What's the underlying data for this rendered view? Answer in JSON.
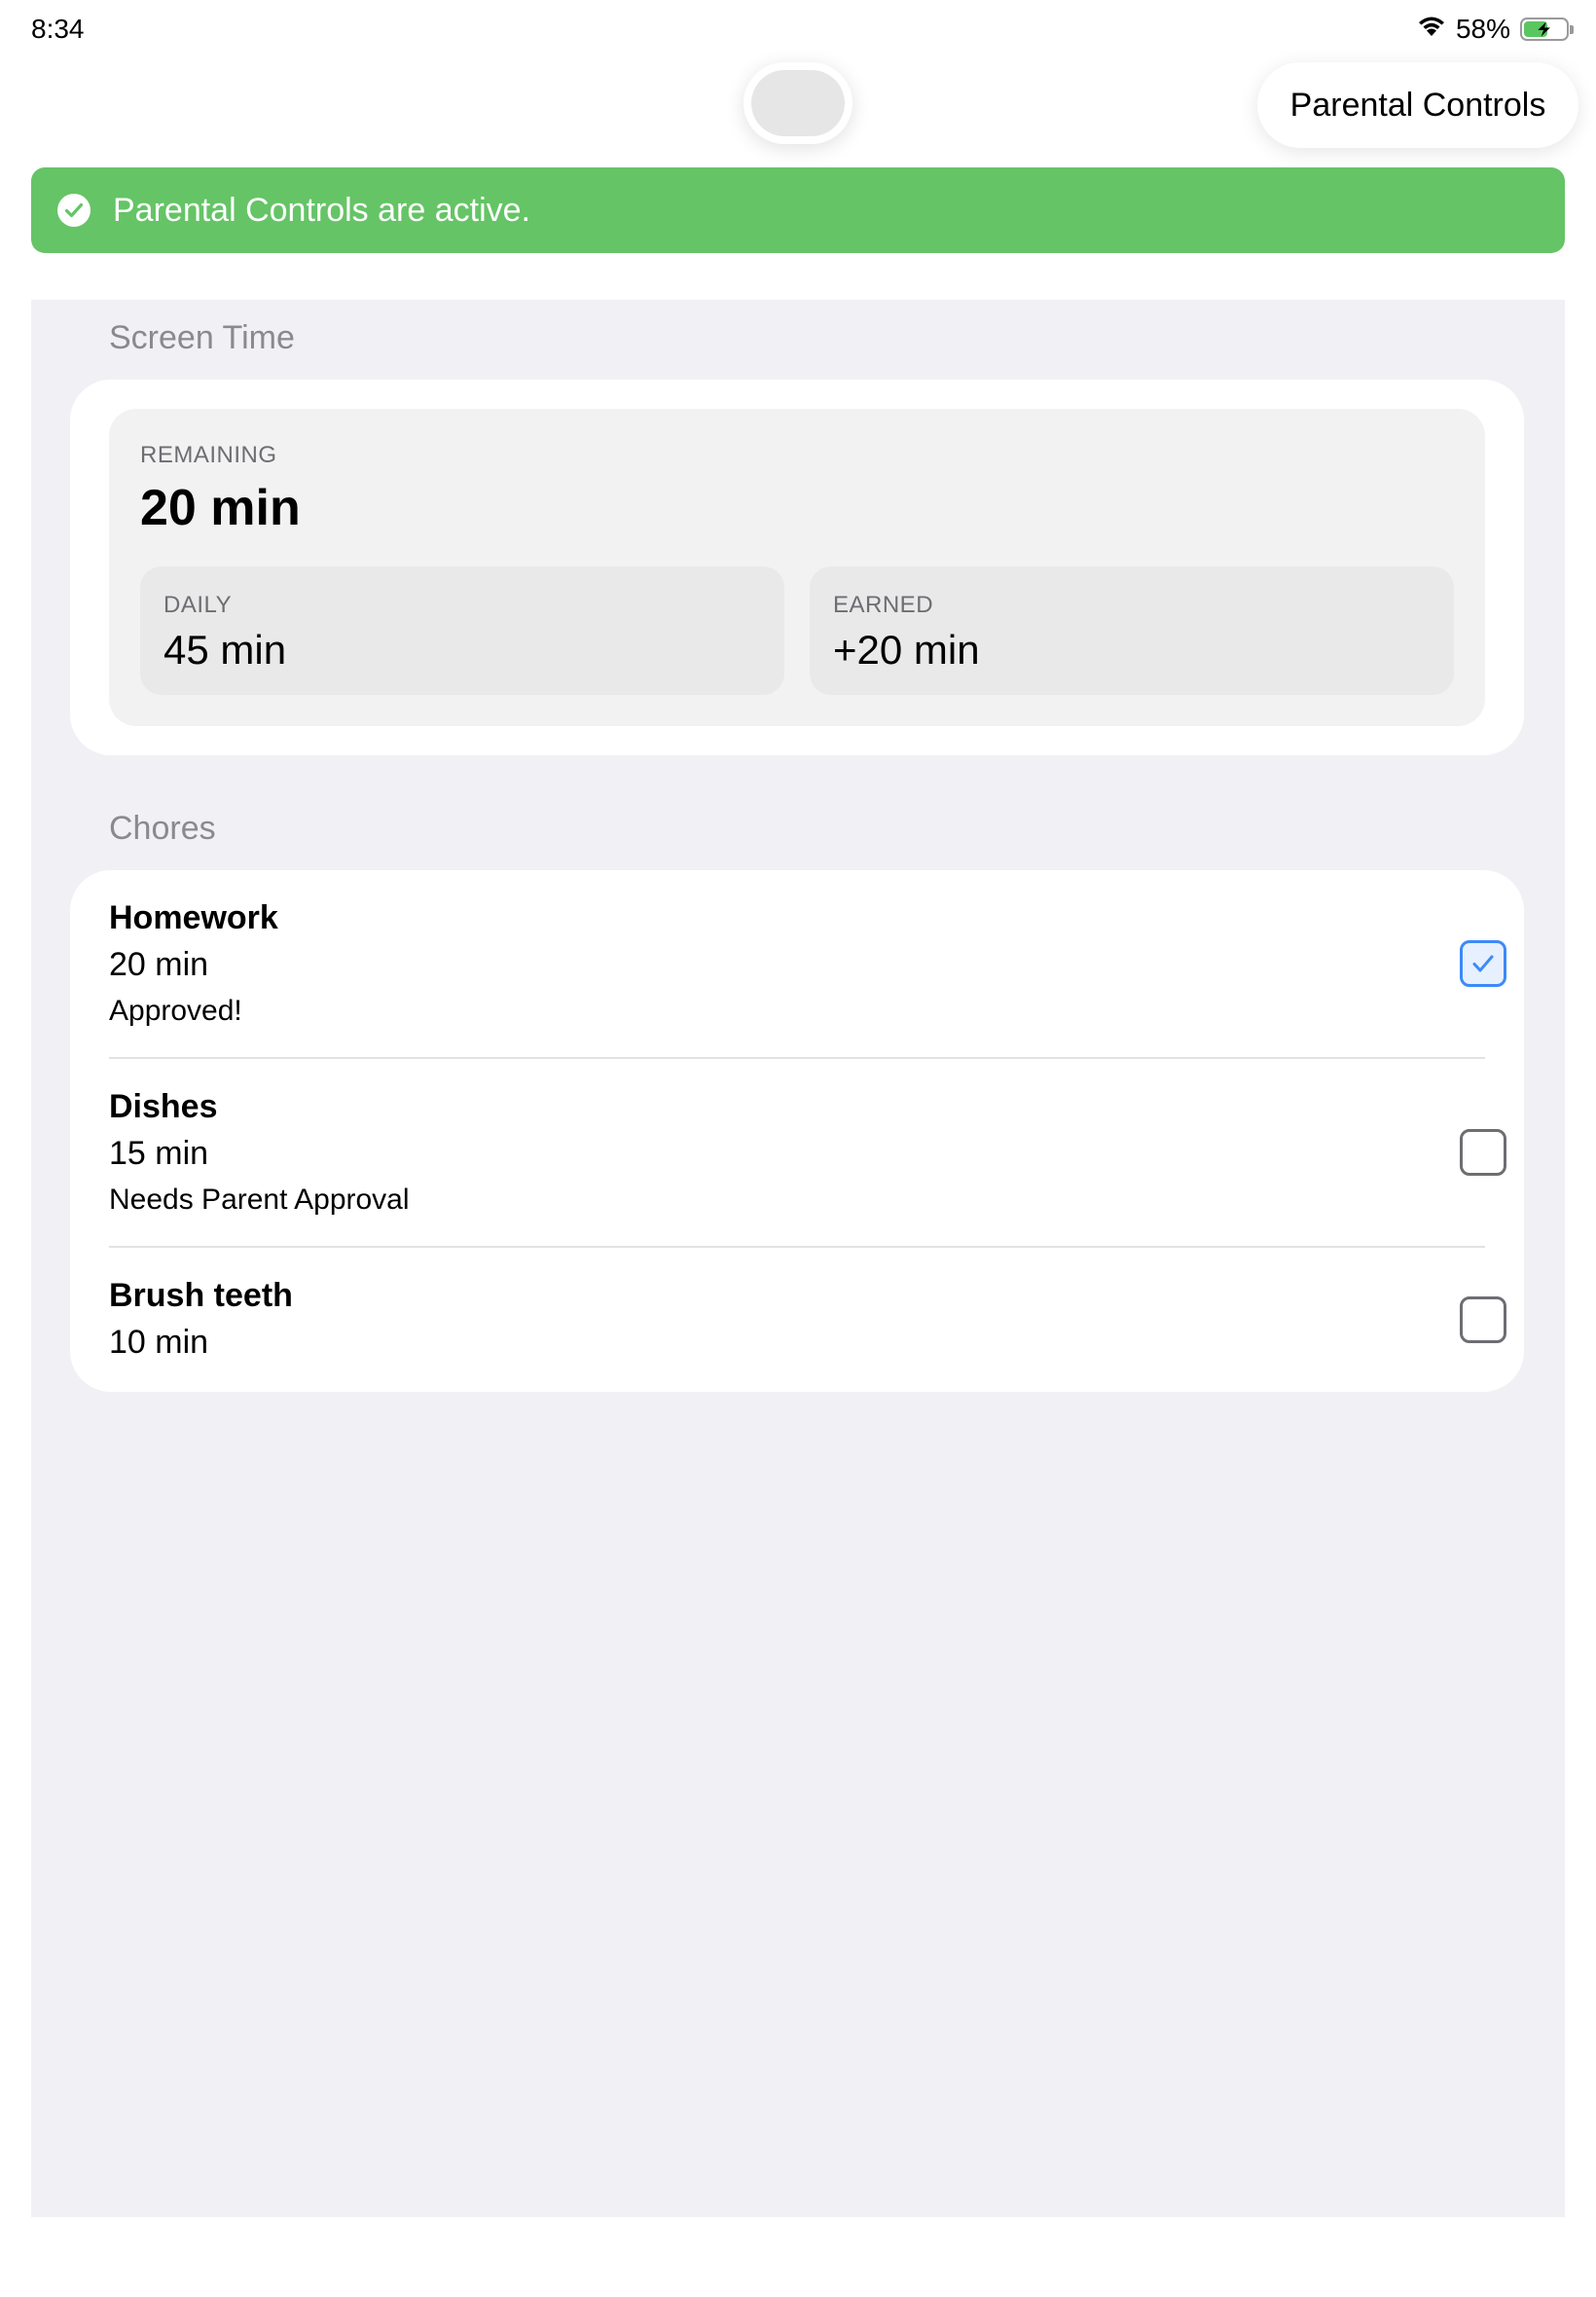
{
  "status_bar": {
    "time": "8:34",
    "battery_percent": "58%",
    "battery_level": 0.58,
    "icons": [
      "wifi-icon",
      "battery-charging-icon"
    ]
  },
  "toolbar": {
    "parental_controls_label": "Parental Controls"
  },
  "banner": {
    "text": "Parental Controls are active.",
    "color": "#65c466",
    "icon": "checkmark-circle-icon"
  },
  "screen_time": {
    "section_title": "Screen Time",
    "remaining_label": "REMAINING",
    "remaining_value": "20 min",
    "daily_label": "DAILY",
    "daily_value": "45 min",
    "earned_label": "EARNED",
    "earned_value": "+20 min"
  },
  "chores": {
    "section_title": "Chores",
    "items": [
      {
        "name": "Homework",
        "minutes": "20 min",
        "status": "Approved!",
        "checked": true
      },
      {
        "name": "Dishes",
        "minutes": "15 min",
        "status": "Needs Parent Approval",
        "checked": false
      },
      {
        "name": "Brush teeth",
        "minutes": "10 min",
        "status": "",
        "checked": false
      }
    ]
  },
  "colors": {
    "accent": "#3d8af7",
    "panel_bg": "#f1f0f5"
  }
}
